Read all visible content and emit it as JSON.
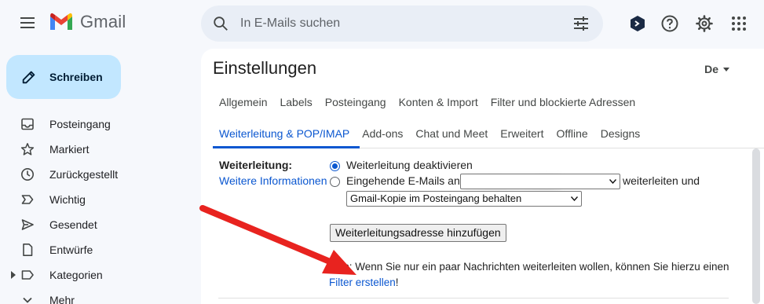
{
  "header": {
    "brand": "Gmail",
    "search_placeholder": "In E-Mails suchen"
  },
  "compose": {
    "label": "Schreiben"
  },
  "sidebar": {
    "items": [
      {
        "label": "Posteingang",
        "icon": "inbox-icon"
      },
      {
        "label": "Markiert",
        "icon": "star-icon"
      },
      {
        "label": "Zurückgestellt",
        "icon": "clock-icon"
      },
      {
        "label": "Wichtig",
        "icon": "important-icon"
      },
      {
        "label": "Gesendet",
        "icon": "send-icon"
      },
      {
        "label": "Entwürfe",
        "icon": "draft-icon"
      },
      {
        "label": "Kategorien",
        "icon": "label-icon"
      },
      {
        "label": "Mehr",
        "icon": "chevron-down-icon"
      }
    ]
  },
  "settings": {
    "title": "Einstellungen",
    "language": "De",
    "tabs_row1": [
      "Allgemein",
      "Labels",
      "Posteingang",
      "Konten & Import",
      "Filter und blockierte Adressen"
    ],
    "tabs_row2": [
      "Weiterleitung & POP/IMAP",
      "Add-ons",
      "Chat und Meet",
      "Erweitert",
      "Offline",
      "Designs"
    ],
    "active_tab": "Weiterleitung & POP/IMAP",
    "forwarding": {
      "label": "Weiterleitung:",
      "more_info": "Weitere Informationen",
      "option_disable": "Weiterleitung deaktivieren",
      "option_forward_prefix": "Eingehende E-Mails an",
      "option_forward_suffix": "weiterleiten und",
      "copy_select_value": "Gmail-Kopie im Posteingang behalten",
      "add_button": "Weiterleitungsadresse hinzufügen",
      "tip_prefix": "Tipp: Wenn Sie nur ein paar Nachrichten weiterleiten wollen, können Sie hierzu einen ",
      "tip_link": "Filter erstellen",
      "tip_suffix": "!"
    }
  },
  "colors": {
    "accent": "#0b57d0",
    "compose_bg": "#c2e7ff",
    "background": "#f6f8fc",
    "arrow": "#e8231f"
  }
}
